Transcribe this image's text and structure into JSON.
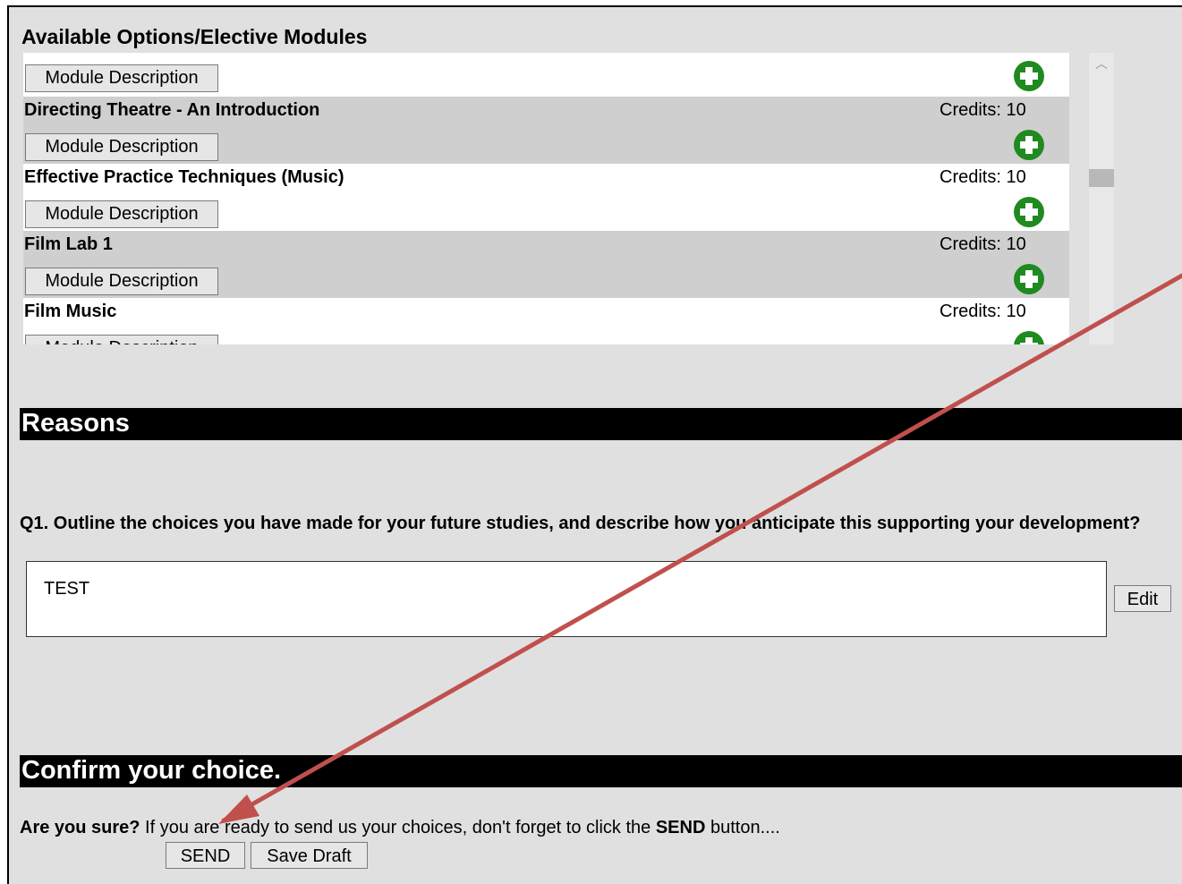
{
  "modules": {
    "title": "Available Options/Elective Modules",
    "rows": [
      {
        "name": "",
        "credits": "",
        "description_label": "Module Description",
        "shade": "white"
      },
      {
        "name": "Directing Theatre - An Introduction",
        "credits": "Credits: 10",
        "description_label": "Module Description",
        "shade": "grey"
      },
      {
        "name": "Effective Practice Techniques (Music)",
        "credits": "Credits: 10",
        "description_label": "Module Description",
        "shade": "white"
      },
      {
        "name": "Film Lab 1",
        "credits": "Credits: 10",
        "description_label": "Module Description",
        "shade": "grey"
      },
      {
        "name": "Film Music",
        "credits": "Credits: 10",
        "description_label": "Module Description",
        "shade": "white"
      }
    ],
    "add_icon": "plus-circle-icon",
    "add_color": "#1f8a1f"
  },
  "reasons": {
    "title": "Reasons",
    "question": "Q1. Outline the choices you have made for your future studies, and describe how you anticipate this supporting your development?",
    "answer": "TEST",
    "edit_label": "Edit"
  },
  "confirm": {
    "title": "Confirm your choice.",
    "lead": "Are you sure?",
    "text_before": " If you are ready to send us your choices, don't forget to click the ",
    "emphasis": "SEND",
    "text_after": " button....",
    "send_label": "SEND",
    "save_draft_label": "Save Draft"
  },
  "annotation": {
    "arrow_color": "#c0504d"
  }
}
